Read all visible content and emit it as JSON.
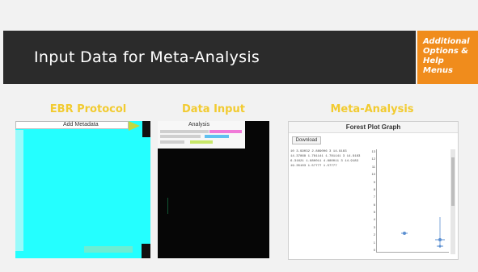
{
  "slide": {
    "title": "Input Data for Meta-Analysis",
    "help": {
      "lines": [
        "Additional",
        "Options &",
        "Help Menus"
      ],
      "color": "#f08c1c"
    },
    "panels": [
      {
        "label": "EBR Protocol",
        "header": "Add Metadata"
      },
      {
        "label": "Data Input",
        "header": "Analysis"
      },
      {
        "label": "Meta-Analysis",
        "header": "Forest Plot Graph",
        "download_label": "Download",
        "rows": [
          "10 3.99032 2.889006 3 14.9183",
          "14.37868 1.781141 1.781141 3 14.9183",
          "6.31621 1.880011 4.880011 3 14.9183",
          "19.35103 1.57777 1.57777"
        ],
        "y_ticks": [
          "13",
          "12",
          "11",
          "10",
          "9",
          "8",
          "7",
          "6",
          "5",
          "4",
          "3",
          "2",
          "1",
          "0"
        ]
      }
    ]
  }
}
